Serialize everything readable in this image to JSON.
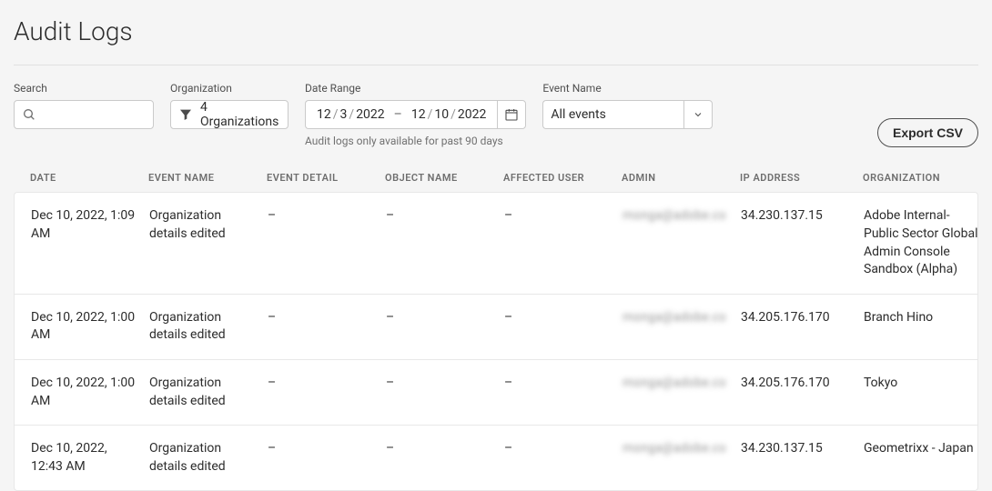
{
  "page_title": "Audit Logs",
  "filters": {
    "search": {
      "label": "Search",
      "value": ""
    },
    "organization": {
      "label": "Organization",
      "value": "4 Organizations"
    },
    "date_range": {
      "label": "Date Range",
      "from": {
        "mm": "12",
        "dd": "3",
        "yyyy": "2022"
      },
      "to": {
        "mm": "12",
        "dd": "10",
        "yyyy": "2022"
      },
      "helper": "Audit logs only available for past 90 days"
    },
    "event_name": {
      "label": "Event Name",
      "value": "All events"
    }
  },
  "export_label": "Export CSV",
  "columns": {
    "date": "DATE",
    "event_name": "EVENT NAME",
    "event_detail": "EVENT DETAIL",
    "object_name": "OBJECT NAME",
    "affected_user": "AFFECTED USER",
    "admin": "ADMIN",
    "ip_address": "IP ADDRESS",
    "organization": "ORGANIZATION"
  },
  "rows": [
    {
      "date": "Dec 10, 2022, 1:09 AM",
      "event_name": "Organization details edited",
      "event_detail": "–",
      "object_name": "–",
      "affected_user": "–",
      "admin": "monga@adobe.co",
      "ip_address": "34.230.137.15",
      "organization": "Adobe Internal-Public Sector Global Admin Console Sandbox (Alpha)"
    },
    {
      "date": "Dec 10, 2022, 1:00 AM",
      "event_name": "Organization details edited",
      "event_detail": "–",
      "object_name": "–",
      "affected_user": "–",
      "admin": "monga@adobe.co",
      "ip_address": "34.205.176.170",
      "organization": "Branch Hino"
    },
    {
      "date": "Dec 10, 2022, 1:00 AM",
      "event_name": "Organization details edited",
      "event_detail": "–",
      "object_name": "–",
      "affected_user": "–",
      "admin": "monga@adobe.co",
      "ip_address": "34.205.176.170",
      "organization": "Tokyo"
    },
    {
      "date": "Dec 10, 2022, 12:43 AM",
      "event_name": "Organization details edited",
      "event_detail": "–",
      "object_name": "–",
      "affected_user": "–",
      "admin": "monga@adobe.co",
      "ip_address": "34.230.137.15",
      "organization": "Geometrixx - Japan"
    }
  ]
}
